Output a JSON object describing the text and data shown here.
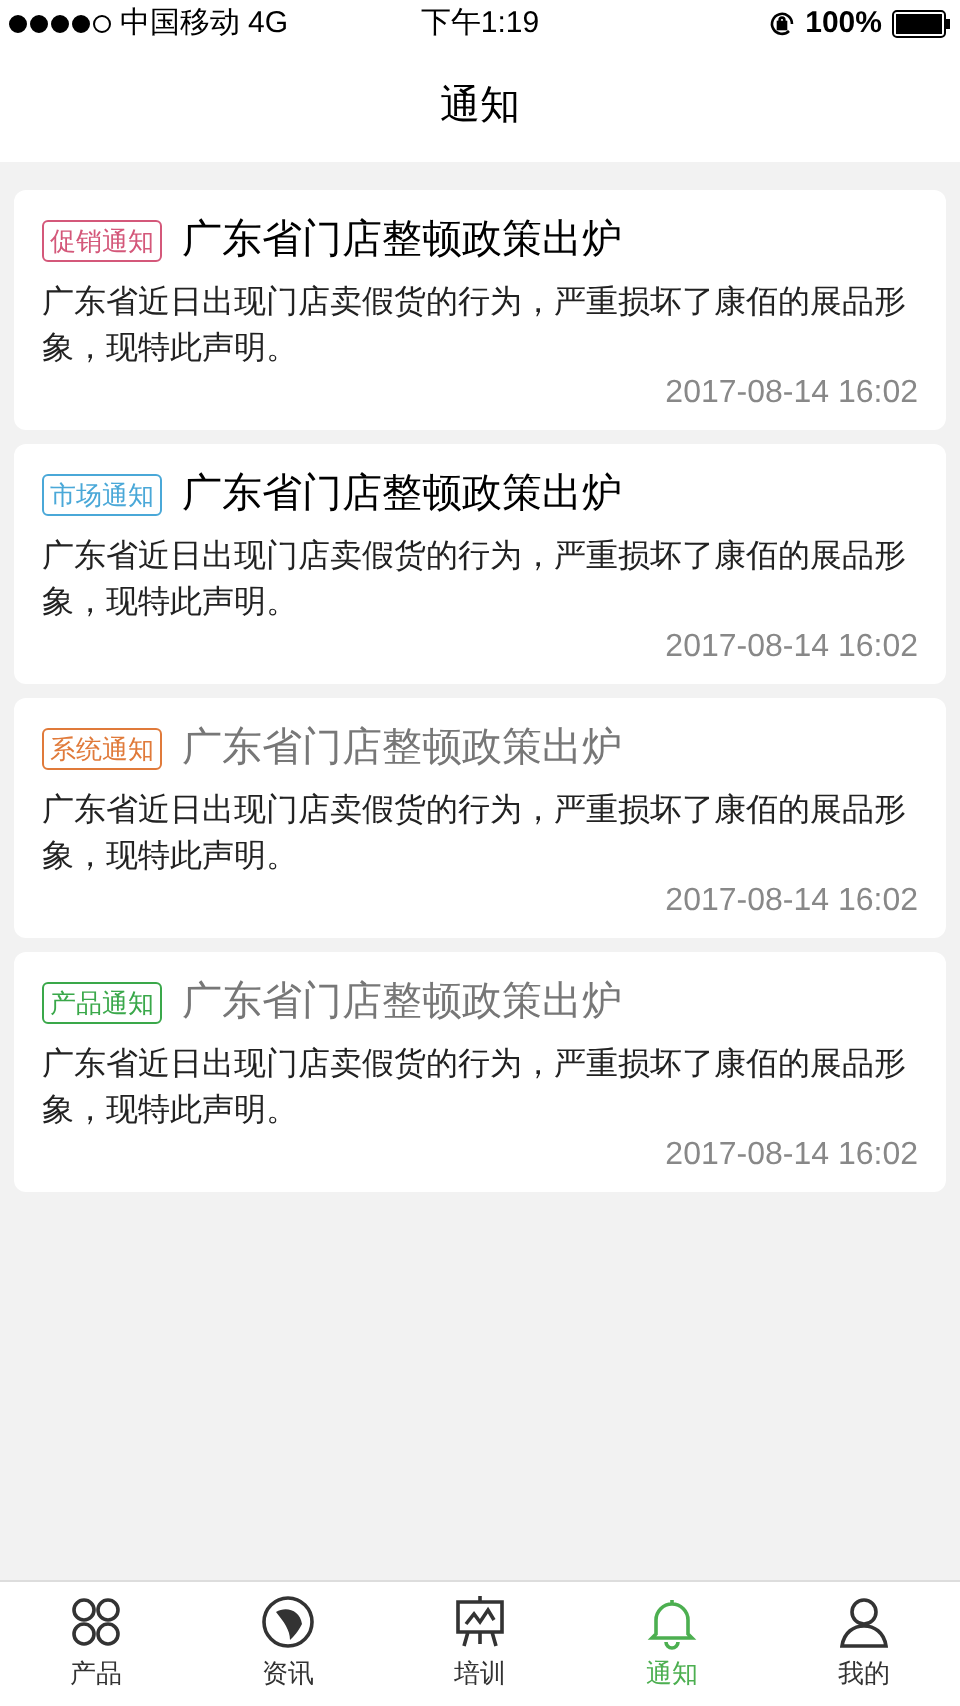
{
  "status_bar": {
    "carrier": "中国移动",
    "network": "4G",
    "time": "下午1:19",
    "battery": "100%"
  },
  "header": {
    "title": "通知"
  },
  "notices": [
    {
      "tag": "促销通知",
      "color": "#d4587a",
      "title": "广东省门店整顿政策出炉",
      "body": "广东省近日出现门店卖假货的行为，严重损坏了康佰的展品形象，现特此声明。",
      "time": "2017-08-14 16:02",
      "read": false
    },
    {
      "tag": "市场通知",
      "color": "#4aa8d8",
      "title": "广东省门店整顿政策出炉",
      "body": "广东省近日出现门店卖假货的行为，严重损坏了康佰的展品形象，现特此声明。",
      "time": "2017-08-14 16:02",
      "read": false
    },
    {
      "tag": "系统通知",
      "color": "#e07a3a",
      "title": "广东省门店整顿政策出炉",
      "body": "广东省近日出现门店卖假货的行为，严重损坏了康佰的展品形象，现特此声明。",
      "time": "2017-08-14 16:02",
      "read": true
    },
    {
      "tag": "产品通知",
      "color": "#3aa84a",
      "title": "广东省门店整顿政策出炉",
      "body": "广东省近日出现门店卖假货的行为，严重损坏了康佰的展品形象，现特此声明。",
      "time": "2017-08-14 16:02",
      "read": true
    }
  ],
  "tab_bar": [
    {
      "kind": "grid",
      "label": "产品",
      "selected": false
    },
    {
      "kind": "globe",
      "label": "资讯",
      "selected": false
    },
    {
      "kind": "board",
      "label": "培训",
      "selected": false
    },
    {
      "kind": "bell",
      "label": "通知",
      "selected": true
    },
    {
      "kind": "person",
      "label": "我的",
      "selected": false
    }
  ]
}
